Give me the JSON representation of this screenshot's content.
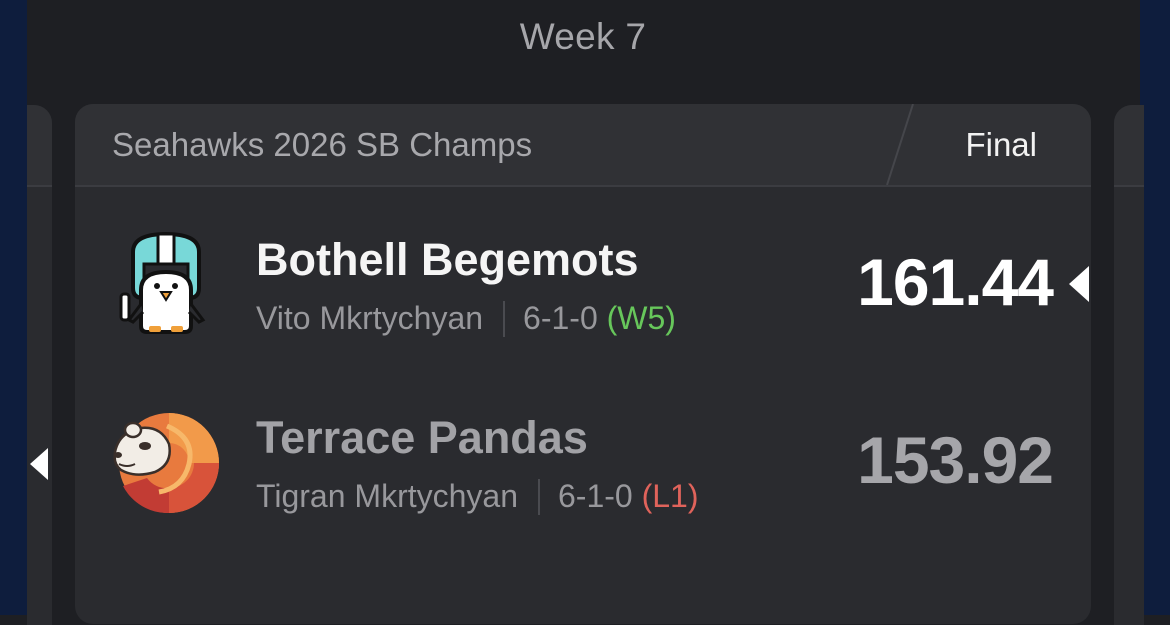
{
  "week": {
    "title": "Week 7"
  },
  "matchup": {
    "league_name": "Seahawks 2026 SB Champs",
    "status": "Final",
    "teams": [
      {
        "name": "Bothell Begemots",
        "owner": "Vito Mkrtychyan",
        "record": "6-1-0",
        "streak": "(W5)",
        "score": "161.44",
        "winner": true,
        "logo_icon": "penguin-helmet-icon"
      },
      {
        "name": "Terrace Pandas",
        "owner": "Tigran Mkrtychyan",
        "record": "6-1-0",
        "streak": "(L1)",
        "score": "153.92",
        "winner": false,
        "logo_icon": "panda-swirl-icon"
      }
    ]
  },
  "colors": {
    "background": "#1e1f23",
    "card": "#2a2b2f",
    "card_header": "#303135",
    "streak_win": "#67c75b",
    "streak_loss": "#e0635b",
    "edge": "#0e1d3d"
  }
}
